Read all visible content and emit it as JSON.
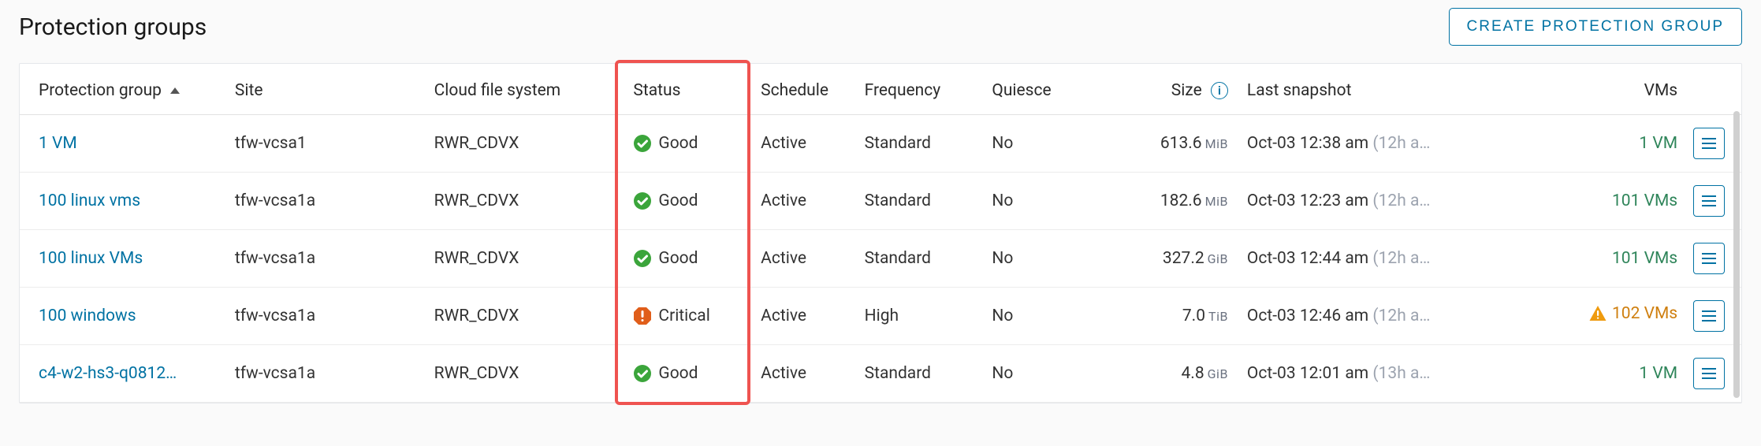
{
  "header": {
    "title": "Protection groups",
    "create_button": "Create Protection Group"
  },
  "columns": {
    "pg": "Protection group",
    "site": "Site",
    "cfs": "Cloud file system",
    "status": "Status",
    "schedule": "Schedule",
    "frequency": "Frequency",
    "quiesce": "Quiesce",
    "size": "Size",
    "snapshot": "Last snapshot",
    "vms": "VMs"
  },
  "sort": {
    "column": "pg",
    "dir": "asc"
  },
  "rows": [
    {
      "name": "1 VM",
      "site": "tfw-vcsa1",
      "cfs": "RWR_CDVX",
      "status": {
        "level": "good",
        "label": "Good"
      },
      "schedule": "Active",
      "frequency": "Standard",
      "quiesce": "No",
      "size": {
        "value": "613.6",
        "unit": "MiB"
      },
      "snapshot": {
        "ts": "Oct-03 12:38 am",
        "ago": "(12h a…"
      },
      "vms": {
        "count": "1 VM",
        "warn": false
      }
    },
    {
      "name": "100 linux vms",
      "site": "tfw-vcsa1a",
      "cfs": "RWR_CDVX",
      "status": {
        "level": "good",
        "label": "Good"
      },
      "schedule": "Active",
      "frequency": "Standard",
      "quiesce": "No",
      "size": {
        "value": "182.6",
        "unit": "MiB"
      },
      "snapshot": {
        "ts": "Oct-03 12:23 am",
        "ago": "(12h a…"
      },
      "vms": {
        "count": "101 VMs",
        "warn": false
      }
    },
    {
      "name": "100 linux VMs",
      "site": "tfw-vcsa1a",
      "cfs": "RWR_CDVX",
      "status": {
        "level": "good",
        "label": "Good"
      },
      "schedule": "Active",
      "frequency": "Standard",
      "quiesce": "No",
      "size": {
        "value": "327.2",
        "unit": "GiB"
      },
      "snapshot": {
        "ts": "Oct-03 12:44 am",
        "ago": "(12h a…"
      },
      "vms": {
        "count": "101 VMs",
        "warn": false
      }
    },
    {
      "name": "100 windows",
      "site": "tfw-vcsa1a",
      "cfs": "RWR_CDVX",
      "status": {
        "level": "critical",
        "label": "Critical"
      },
      "schedule": "Active",
      "frequency": "High",
      "quiesce": "No",
      "size": {
        "value": "7.0",
        "unit": "TiB"
      },
      "snapshot": {
        "ts": "Oct-03 12:46 am",
        "ago": "(12h a…"
      },
      "vms": {
        "count": "102 VMs",
        "warn": true
      }
    },
    {
      "name": "c4-w2-hs3-q0812…",
      "site": "tfw-vcsa1a",
      "cfs": "RWR_CDVX",
      "status": {
        "level": "good",
        "label": "Good"
      },
      "schedule": "Active",
      "frequency": "Standard",
      "quiesce": "No",
      "size": {
        "value": "4.8",
        "unit": "GiB"
      },
      "snapshot": {
        "ts": "Oct-03 12:01 am",
        "ago": "(13h a…"
      },
      "vms": {
        "count": "1 VM",
        "warn": false
      }
    }
  ],
  "highlight": {
    "column": "status"
  }
}
